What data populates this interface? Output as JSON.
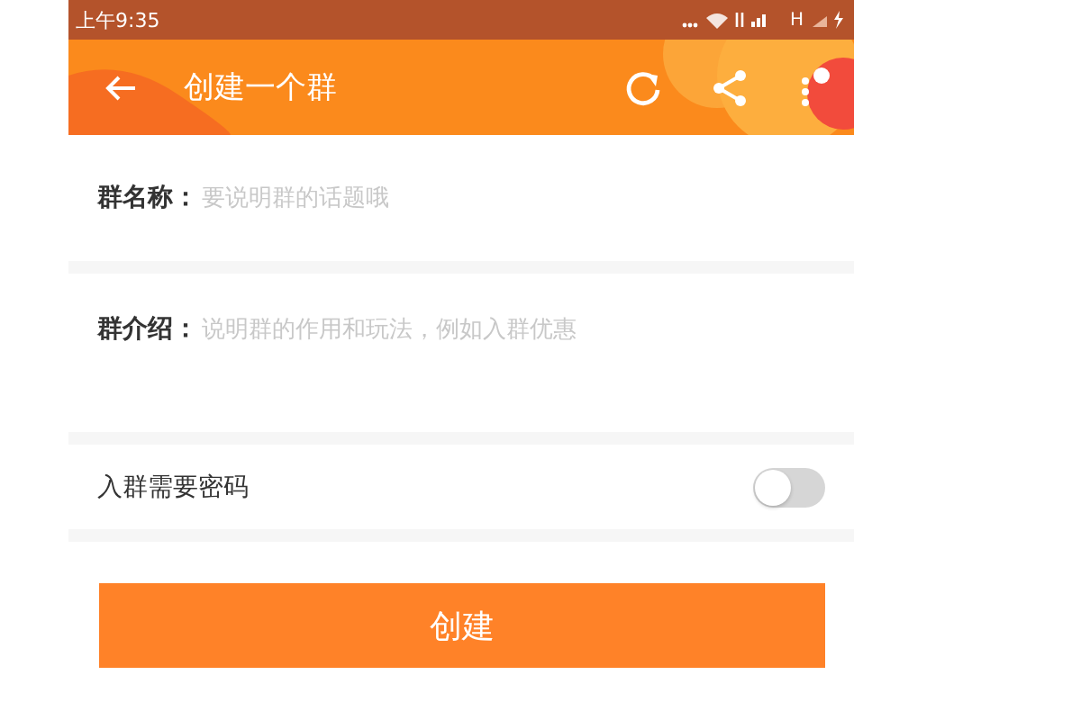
{
  "status_bar": {
    "time": "上午9:35",
    "network": "H"
  },
  "header": {
    "title": "创建一个群"
  },
  "fields": [
    {
      "label": "群名称：",
      "placeholder": "要说明群的话题哦",
      "kind": "line"
    },
    {
      "label": "群介绍：",
      "placeholder": "说明群的作用和玩法，例如入群优惠",
      "kind": "area"
    }
  ],
  "password": {
    "label": "入群需要密码",
    "on": false
  },
  "submit": "创建"
}
